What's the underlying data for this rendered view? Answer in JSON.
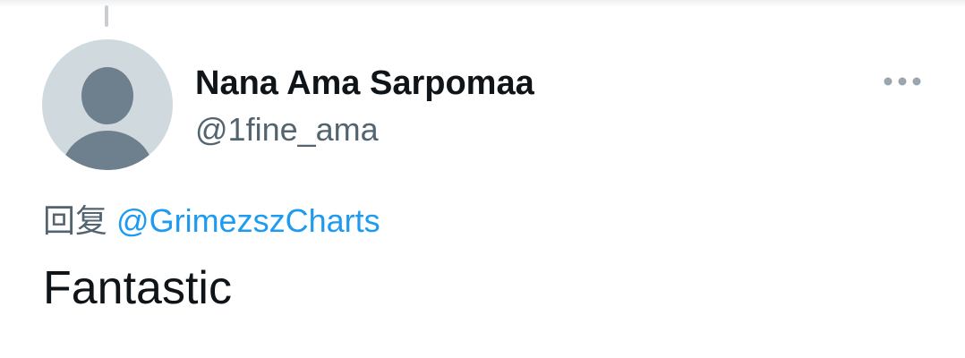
{
  "author": {
    "display_name": "Nana Ama Sarpomaa",
    "handle": "@1fine_ama",
    "avatar_icon": "default-profile-icon"
  },
  "reply": {
    "prefix": "回复",
    "mention": "@GrimezszCharts"
  },
  "tweet": {
    "text": "Fantastic"
  },
  "more_icon": "more-horizontal-icon",
  "colors": {
    "link": "#1d9bf0",
    "text": "#0f1419",
    "secondary": "#536471",
    "avatar_bg": "#cfd9de",
    "avatar_fg": "#6e7f8d"
  }
}
